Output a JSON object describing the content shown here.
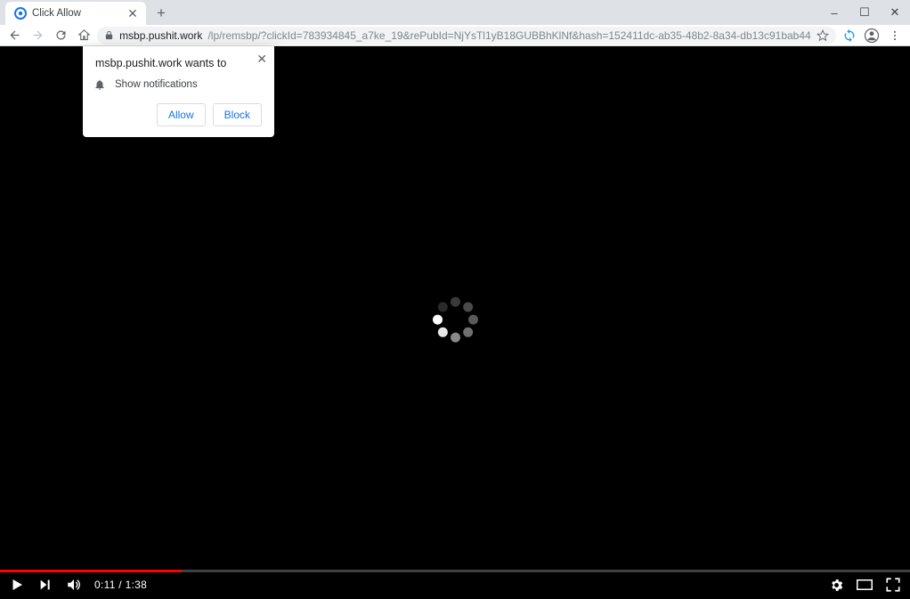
{
  "window": {
    "minimize": "–",
    "maximize": "☐",
    "close": "✕"
  },
  "tab": {
    "title": "Click Allow",
    "close": "✕",
    "newtab": "+"
  },
  "toolbar": {
    "url_main": "msbp.pushit.work",
    "url_rest": "/lp/remsbp/?clickId=783934845_a7ke_19&rePubId=NjYsTl1yB18GUBBhKlNf&hash=152411dc-ab35-48b2-8a34-db13c91bab44"
  },
  "permission": {
    "title": "msbp.pushit.work wants to",
    "item": "Show notifications",
    "allow": "Allow",
    "block": "Block",
    "close": "✕"
  },
  "video": {
    "current": "0:11",
    "duration": "1:38",
    "sep": " / ",
    "progress_percent": 20
  },
  "spinner": {
    "dots": [
      {
        "angle": 0,
        "shade": "#3a3a3a"
      },
      {
        "angle": 45,
        "shade": "#4a4a4a"
      },
      {
        "angle": 90,
        "shade": "#5a5a5a"
      },
      {
        "angle": 135,
        "shade": "#707070"
      },
      {
        "angle": 180,
        "shade": "#8a8a8a"
      },
      {
        "angle": 225,
        "shade": "#e8e8e8"
      },
      {
        "angle": 270,
        "shade": "#ffffff"
      },
      {
        "angle": 315,
        "shade": "#2a2a2a"
      }
    ]
  },
  "colors": {
    "accent": "#1a73e8",
    "progress": "#ff0000",
    "sync": "#1a9cff"
  }
}
